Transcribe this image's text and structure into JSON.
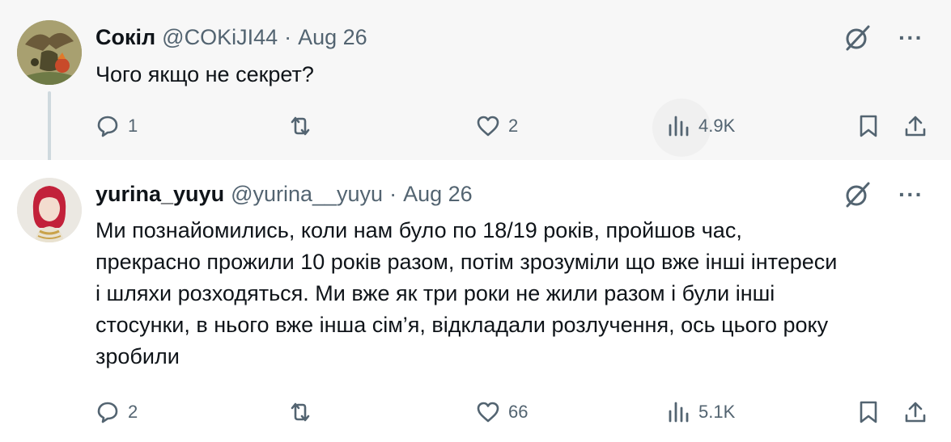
{
  "tweets": [
    {
      "name": "Сокіл",
      "handle": "@COKiJI44",
      "separator": "·",
      "date": "Aug 26",
      "text": "Чого якщо не секрет?",
      "replies": "1",
      "retweets": "",
      "likes": "2",
      "views": "4.9K"
    },
    {
      "name": "yurina_yuyu",
      "handle": "@yurina__yuyu",
      "separator": "·",
      "date": "Aug 26",
      "text": "Ми познайомились, коли нам було по 18/19 років, пройшов час, прекрасно прожили 10 років разом, потім зрозуміли що вже інші інтереси і шляхи розходяться. Ми вже як три роки не жили разом і були інші стосунки, в нього вже інша сім’я, відкладали розлучення, ось цього року зробили",
      "replies": "2",
      "retweets": "",
      "likes": "66",
      "views": "5.1K"
    }
  ],
  "icons": {
    "more": "···",
    "grok": "grok-icon",
    "reply": "reply-icon",
    "retweet": "retweet-icon",
    "like": "heart-icon",
    "views": "views-icon",
    "bookmark": "bookmark-icon",
    "share": "share-icon"
  },
  "colors": {
    "text": "#0f1419",
    "secondary": "#536471",
    "thread_line": "#cfd9de",
    "highlight_bg": "#f7f7f7"
  }
}
